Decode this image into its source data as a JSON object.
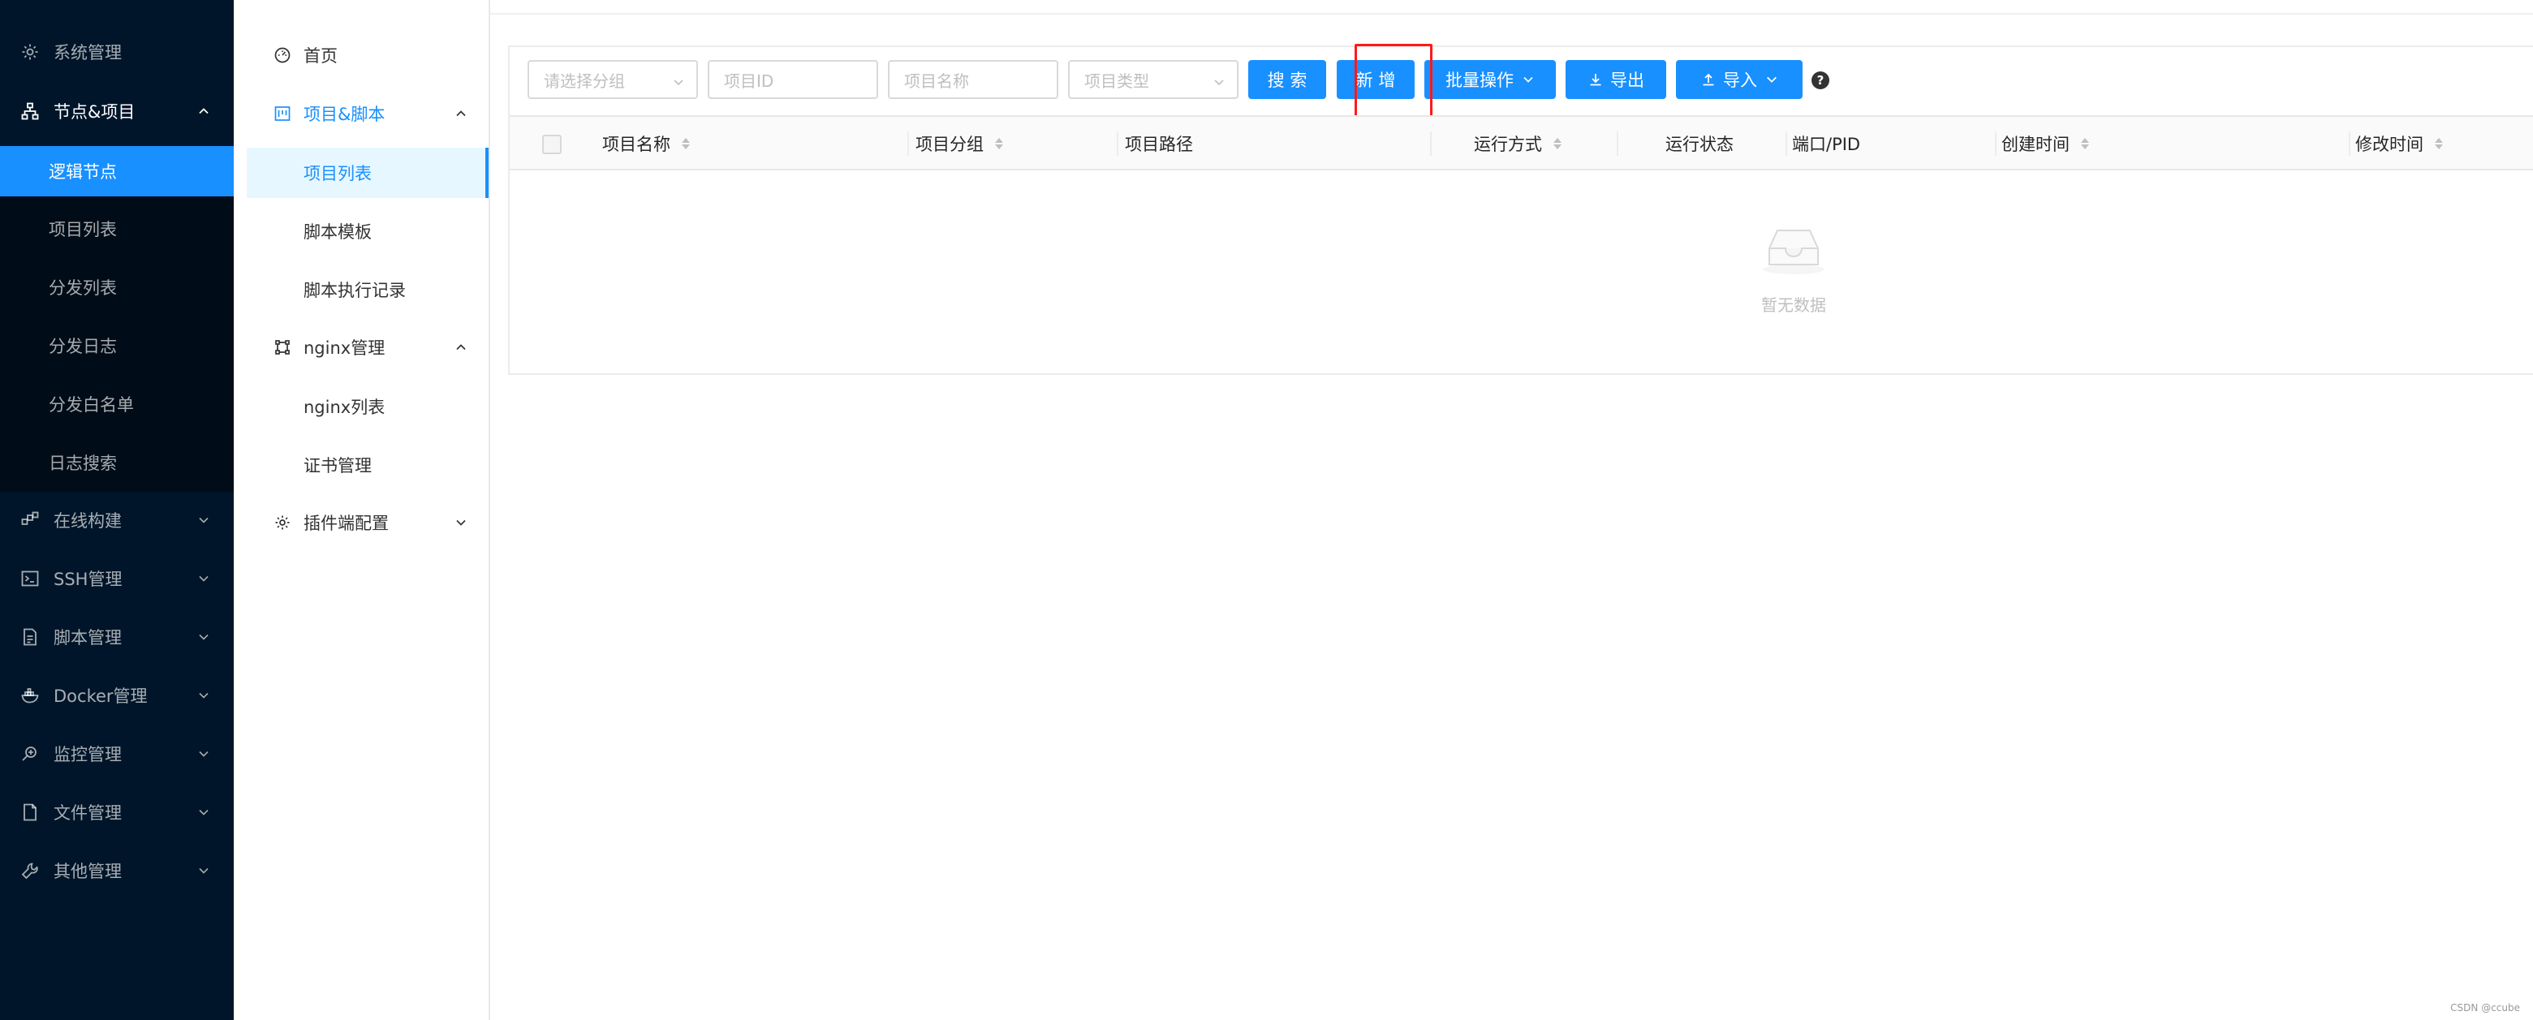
{
  "colors": {
    "sider_bg": "#001529",
    "accent": "#1890ff",
    "highlight": "#ff1a1a"
  },
  "sidebar": {
    "items": [
      {
        "label": "系统管理",
        "icon": "gear-icon"
      },
      {
        "label": "节点&项目",
        "icon": "sitemap-icon"
      },
      {
        "label": "在线构建",
        "icon": "build-icon"
      },
      {
        "label": "SSH管理",
        "icon": "terminal-icon"
      },
      {
        "label": "脚本管理",
        "icon": "file-script-icon"
      },
      {
        "label": "Docker管理",
        "icon": "docker-icon"
      },
      {
        "label": "监控管理",
        "icon": "monitor-search-icon"
      },
      {
        "label": "文件管理",
        "icon": "file-icon"
      },
      {
        "label": "其他管理",
        "icon": "wrench-icon"
      }
    ],
    "subitems": [
      "逻辑节点",
      "项目列表",
      "分发列表",
      "分发日志",
      "分发白名单",
      "日志搜索"
    ]
  },
  "menu2": {
    "home": "首页",
    "group1": "项目&脚本",
    "group1_items": [
      "项目列表",
      "脚本模板",
      "脚本执行记录"
    ],
    "group2": "nginx管理",
    "group2_items": [
      "nginx列表",
      "证书管理"
    ],
    "group3": "插件端配置"
  },
  "toolbar": {
    "group_placeholder": "请选择分组",
    "id_placeholder": "项目ID",
    "name_placeholder": "项目名称",
    "type_placeholder": "项目类型",
    "search_label": "搜 索",
    "add_label": "新 增",
    "batch_label": "批量操作",
    "export_label": "导出",
    "import_label": "导入",
    "help_label": "?"
  },
  "table": {
    "columns": [
      "项目名称",
      "项目分组",
      "项目路径",
      "运行方式",
      "运行状态",
      "端口/PID",
      "创建时间",
      "修改时间"
    ],
    "empty_text": "暂无数据"
  },
  "watermark": "CSDN @ccube"
}
